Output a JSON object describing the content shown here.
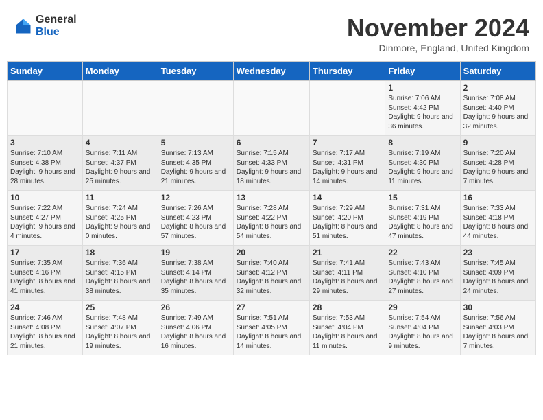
{
  "header": {
    "logo_general": "General",
    "logo_blue": "Blue",
    "month_title": "November 2024",
    "location": "Dinmore, England, United Kingdom"
  },
  "weekdays": [
    "Sunday",
    "Monday",
    "Tuesday",
    "Wednesday",
    "Thursday",
    "Friday",
    "Saturday"
  ],
  "weeks": [
    [
      {
        "day": "",
        "info": ""
      },
      {
        "day": "",
        "info": ""
      },
      {
        "day": "",
        "info": ""
      },
      {
        "day": "",
        "info": ""
      },
      {
        "day": "",
        "info": ""
      },
      {
        "day": "1",
        "info": "Sunrise: 7:06 AM\nSunset: 4:42 PM\nDaylight: 9 hours and 36 minutes."
      },
      {
        "day": "2",
        "info": "Sunrise: 7:08 AM\nSunset: 4:40 PM\nDaylight: 9 hours and 32 minutes."
      }
    ],
    [
      {
        "day": "3",
        "info": "Sunrise: 7:10 AM\nSunset: 4:38 PM\nDaylight: 9 hours and 28 minutes."
      },
      {
        "day": "4",
        "info": "Sunrise: 7:11 AM\nSunset: 4:37 PM\nDaylight: 9 hours and 25 minutes."
      },
      {
        "day": "5",
        "info": "Sunrise: 7:13 AM\nSunset: 4:35 PM\nDaylight: 9 hours and 21 minutes."
      },
      {
        "day": "6",
        "info": "Sunrise: 7:15 AM\nSunset: 4:33 PM\nDaylight: 9 hours and 18 minutes."
      },
      {
        "day": "7",
        "info": "Sunrise: 7:17 AM\nSunset: 4:31 PM\nDaylight: 9 hours and 14 minutes."
      },
      {
        "day": "8",
        "info": "Sunrise: 7:19 AM\nSunset: 4:30 PM\nDaylight: 9 hours and 11 minutes."
      },
      {
        "day": "9",
        "info": "Sunrise: 7:20 AM\nSunset: 4:28 PM\nDaylight: 9 hours and 7 minutes."
      }
    ],
    [
      {
        "day": "10",
        "info": "Sunrise: 7:22 AM\nSunset: 4:27 PM\nDaylight: 9 hours and 4 minutes."
      },
      {
        "day": "11",
        "info": "Sunrise: 7:24 AM\nSunset: 4:25 PM\nDaylight: 9 hours and 0 minutes."
      },
      {
        "day": "12",
        "info": "Sunrise: 7:26 AM\nSunset: 4:23 PM\nDaylight: 8 hours and 57 minutes."
      },
      {
        "day": "13",
        "info": "Sunrise: 7:28 AM\nSunset: 4:22 PM\nDaylight: 8 hours and 54 minutes."
      },
      {
        "day": "14",
        "info": "Sunrise: 7:29 AM\nSunset: 4:20 PM\nDaylight: 8 hours and 51 minutes."
      },
      {
        "day": "15",
        "info": "Sunrise: 7:31 AM\nSunset: 4:19 PM\nDaylight: 8 hours and 47 minutes."
      },
      {
        "day": "16",
        "info": "Sunrise: 7:33 AM\nSunset: 4:18 PM\nDaylight: 8 hours and 44 minutes."
      }
    ],
    [
      {
        "day": "17",
        "info": "Sunrise: 7:35 AM\nSunset: 4:16 PM\nDaylight: 8 hours and 41 minutes."
      },
      {
        "day": "18",
        "info": "Sunrise: 7:36 AM\nSunset: 4:15 PM\nDaylight: 8 hours and 38 minutes."
      },
      {
        "day": "19",
        "info": "Sunrise: 7:38 AM\nSunset: 4:14 PM\nDaylight: 8 hours and 35 minutes."
      },
      {
        "day": "20",
        "info": "Sunrise: 7:40 AM\nSunset: 4:12 PM\nDaylight: 8 hours and 32 minutes."
      },
      {
        "day": "21",
        "info": "Sunrise: 7:41 AM\nSunset: 4:11 PM\nDaylight: 8 hours and 29 minutes."
      },
      {
        "day": "22",
        "info": "Sunrise: 7:43 AM\nSunset: 4:10 PM\nDaylight: 8 hours and 27 minutes."
      },
      {
        "day": "23",
        "info": "Sunrise: 7:45 AM\nSunset: 4:09 PM\nDaylight: 8 hours and 24 minutes."
      }
    ],
    [
      {
        "day": "24",
        "info": "Sunrise: 7:46 AM\nSunset: 4:08 PM\nDaylight: 8 hours and 21 minutes."
      },
      {
        "day": "25",
        "info": "Sunrise: 7:48 AM\nSunset: 4:07 PM\nDaylight: 8 hours and 19 minutes."
      },
      {
        "day": "26",
        "info": "Sunrise: 7:49 AM\nSunset: 4:06 PM\nDaylight: 8 hours and 16 minutes."
      },
      {
        "day": "27",
        "info": "Sunrise: 7:51 AM\nSunset: 4:05 PM\nDaylight: 8 hours and 14 minutes."
      },
      {
        "day": "28",
        "info": "Sunrise: 7:53 AM\nSunset: 4:04 PM\nDaylight: 8 hours and 11 minutes."
      },
      {
        "day": "29",
        "info": "Sunrise: 7:54 AM\nSunset: 4:04 PM\nDaylight: 8 hours and 9 minutes."
      },
      {
        "day": "30",
        "info": "Sunrise: 7:56 AM\nSunset: 4:03 PM\nDaylight: 8 hours and 7 minutes."
      }
    ]
  ]
}
